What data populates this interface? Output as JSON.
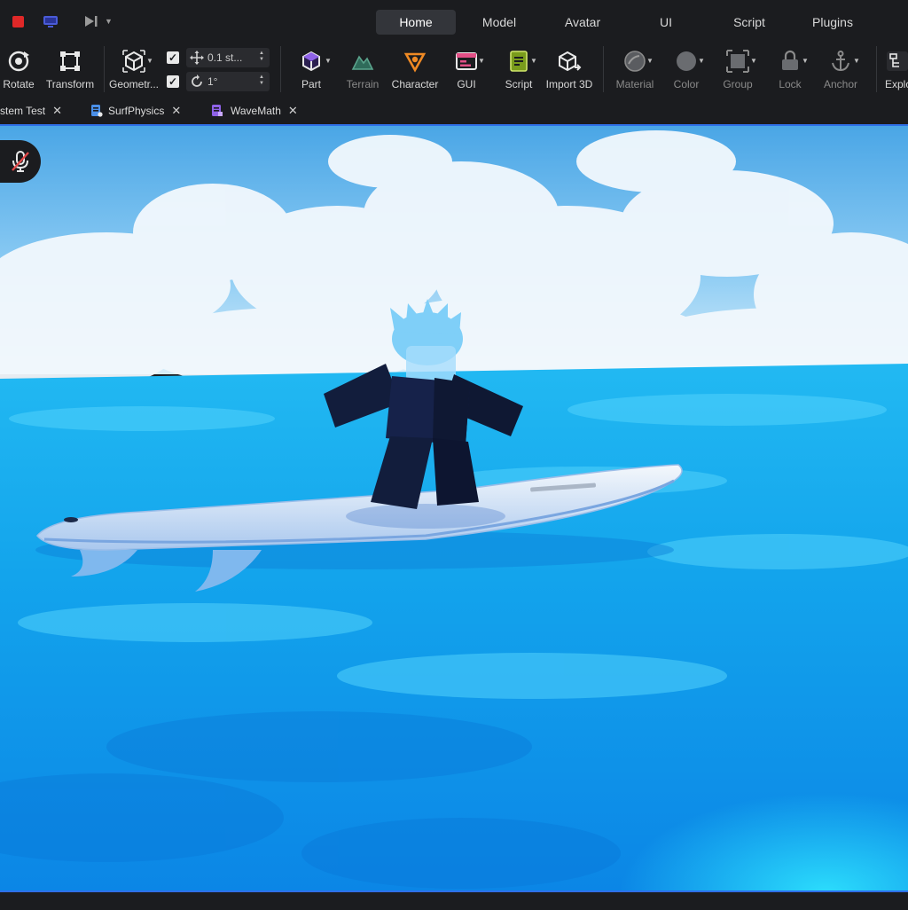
{
  "titlebar": {
    "menu_tabs": [
      {
        "label": "Home",
        "active": true
      },
      {
        "label": "Model",
        "active": false
      },
      {
        "label": "Avatar",
        "active": false
      },
      {
        "label": "UI",
        "active": false
      },
      {
        "label": "Script",
        "active": false
      },
      {
        "label": "Plugins",
        "active": false
      }
    ],
    "stop_color": "#e02828"
  },
  "ribbon": {
    "tools": [
      {
        "label": "Rotate",
        "icon": "rotate-icon"
      },
      {
        "label": "Transform",
        "icon": "transform-icon"
      },
      {
        "label": "Geometr...",
        "icon": "geometry-icon"
      },
      {
        "label": "Part",
        "icon": "part-icon"
      },
      {
        "label": "Terrain",
        "icon": "terrain-icon",
        "disabled": true
      },
      {
        "label": "Character",
        "icon": "character-icon"
      },
      {
        "label": "GUI",
        "icon": "gui-icon"
      },
      {
        "label": "Script",
        "icon": "script-icon"
      },
      {
        "label": "Import 3D",
        "icon": "import-3d-icon"
      },
      {
        "label": "Material",
        "icon": "material-icon",
        "disabled": true
      },
      {
        "label": "Color",
        "icon": "color-icon",
        "disabled": true
      },
      {
        "label": "Group",
        "icon": "group-icon",
        "disabled": true
      },
      {
        "label": "Lock",
        "icon": "lock-icon",
        "disabled": true
      },
      {
        "label": "Anchor",
        "icon": "anchor-icon",
        "disabled": true
      },
      {
        "label": "Explo",
        "icon": "explorer-icon"
      }
    ],
    "move_snap": {
      "checked": true,
      "value": "0.1 st..."
    },
    "rotate_snap": {
      "checked": true,
      "value": "1°"
    }
  },
  "doc_tabs": [
    {
      "label": "stem Test"
    },
    {
      "label": "SurfPhysics"
    },
    {
      "label": "WaveMath"
    }
  ],
  "colors": {
    "accent": "#2f6fe8",
    "ocean": "#1fb4f0",
    "sky": "#5bb7ee",
    "character": "#121d3c"
  }
}
